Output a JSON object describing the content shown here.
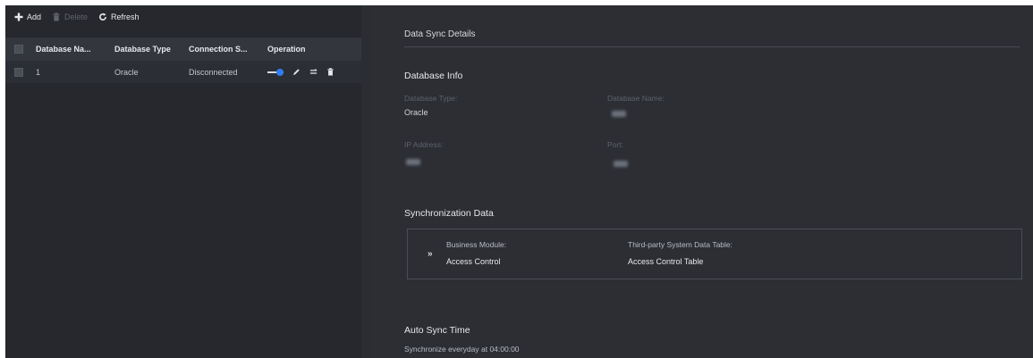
{
  "toolbar": {
    "add_label": "Add",
    "delete_label": "Delete",
    "refresh_label": "Refresh"
  },
  "table": {
    "headers": [
      "Database Na...",
      "Database Type",
      "Connection S...",
      "Operation"
    ],
    "rows": [
      {
        "name": "1",
        "type": "Oracle",
        "connection": "Disconnected",
        "enabled": true
      }
    ]
  },
  "details": {
    "title": "Data Sync Details",
    "database_info": {
      "heading": "Database Info",
      "db_type_label": "Database Type:",
      "db_type_value": "Oracle",
      "db_name_label": "Database Name:",
      "ip_label": "IP Address:",
      "port_label": "Port:"
    },
    "sync_data": {
      "heading": "Synchronization Data",
      "arrow": "»",
      "module_label": "Business Module:",
      "module_value": "Access Control",
      "table_label": "Third-party System Data Table:",
      "table_value": "Access Control Table"
    },
    "auto_sync": {
      "heading": "Auto Sync Time",
      "text": "Synchronize everyday at 04:00:00"
    }
  },
  "colors": {
    "accent": "#2f7df6",
    "panel_left": "#26282e",
    "panel_right": "#2c2e34"
  },
  "icons": [
    "plus-icon",
    "trash-icon",
    "refresh-icon",
    "toggle-switch",
    "pencil-icon",
    "sync-lines-icon",
    "trash-icon"
  ]
}
